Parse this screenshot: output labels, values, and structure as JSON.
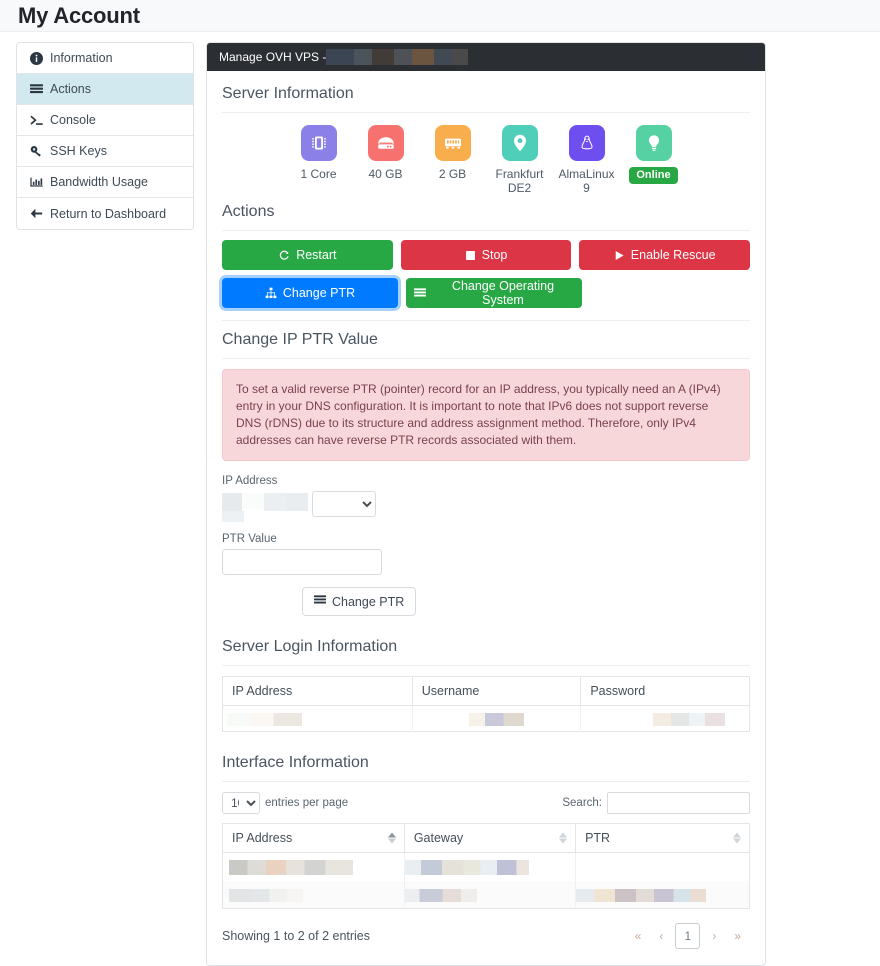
{
  "header": {
    "title": "My Account"
  },
  "sidebar": {
    "items": [
      {
        "label": "Information",
        "icon": "info-circle-icon",
        "active": false
      },
      {
        "label": "Actions",
        "icon": "list-icon",
        "active": true
      },
      {
        "label": "Console",
        "icon": "terminal-icon",
        "active": false
      },
      {
        "label": "SSH Keys",
        "icon": "key-icon",
        "active": false
      },
      {
        "label": "Bandwidth Usage",
        "icon": "chart-bar-icon",
        "active": false
      },
      {
        "label": "Return to Dashboard",
        "icon": "arrow-left-icon",
        "active": false
      }
    ]
  },
  "panel": {
    "title": "Manage OVH VPS - ",
    "title_redacted": true
  },
  "server_information": {
    "heading": "Server Information",
    "specs": [
      {
        "label": "1 Core",
        "icon": "cpu-icon",
        "color": "#8b7fe8"
      },
      {
        "label": "40 GB",
        "icon": "harddisk-icon",
        "color": "#f7726f"
      },
      {
        "label": "2 GB",
        "icon": "memory-icon",
        "color": "#f8ae4d"
      },
      {
        "label": "Frankfurt DE2",
        "icon": "map-pin-icon",
        "color": "#4fcfba"
      },
      {
        "label": "AlmaLinux 9",
        "icon": "linux-icon",
        "color": "#6f4ef0"
      },
      {
        "label": "Online",
        "icon": "lightbulb-icon",
        "color": "#56d1a4",
        "badge": true,
        "badge_color": "#28a745"
      }
    ]
  },
  "actions": {
    "heading": "Actions",
    "buttons": [
      {
        "label": "Restart",
        "icon": "refresh-icon",
        "style": "green",
        "name": "restart-button"
      },
      {
        "label": "Stop",
        "icon": "stop-icon",
        "style": "red",
        "name": "stop-button"
      },
      {
        "label": "Enable Rescue",
        "icon": "play-icon",
        "style": "red",
        "name": "enable-rescue-button"
      },
      {
        "label": "Change PTR",
        "icon": "sitemap-icon",
        "style": "blue",
        "name": "change-ptr-action-button"
      },
      {
        "label": "Change Operating System",
        "icon": "list-icon",
        "style": "green",
        "name": "change-os-button"
      }
    ]
  },
  "change_ptr": {
    "heading": "Change IP PTR Value",
    "alert": "To set a valid reverse PTR (pointer) record for an IP address, you typically need an A (IPv4) entry in your DNS configuration. It is important to note that IPv6 does not support reverse DNS (rDNS) due to its structure and address assignment method. Therefore, only IPv4 addresses can have reverse PTR records associated with them.",
    "ip_label": "IP Address",
    "ip_value": "",
    "ip_redacted": true,
    "ip_select_value": "",
    "ptr_label": "PTR Value",
    "ptr_value": "",
    "ptr_placeholder": "",
    "submit_label": "Change PTR",
    "submit_icon": "list-icon"
  },
  "server_login": {
    "heading": "Server Login Information",
    "columns": [
      "IP Address",
      "Username",
      "Password"
    ],
    "rows": [
      {
        "ip": "",
        "username": "",
        "password": "",
        "redacted": true
      }
    ]
  },
  "interface_information": {
    "heading": "Interface Information",
    "entries_select_value": "10",
    "entries_label": "entries per page",
    "search_label": "Search:",
    "search_value": "",
    "columns": [
      {
        "label": "IP Address",
        "sort": "asc"
      },
      {
        "label": "Gateway",
        "sort": "none"
      },
      {
        "label": "PTR",
        "sort": "none"
      }
    ],
    "rows": [
      {
        "ip": "",
        "gateway": "",
        "ptr": "",
        "redacted": true
      },
      {
        "ip": "",
        "gateway": "",
        "ptr": "",
        "redacted": true
      }
    ],
    "showing_text": "Showing 1 to 2 of 2 entries",
    "pagination": {
      "first": "«",
      "prev": "‹",
      "current": "1",
      "next": "›",
      "last": "»"
    }
  }
}
